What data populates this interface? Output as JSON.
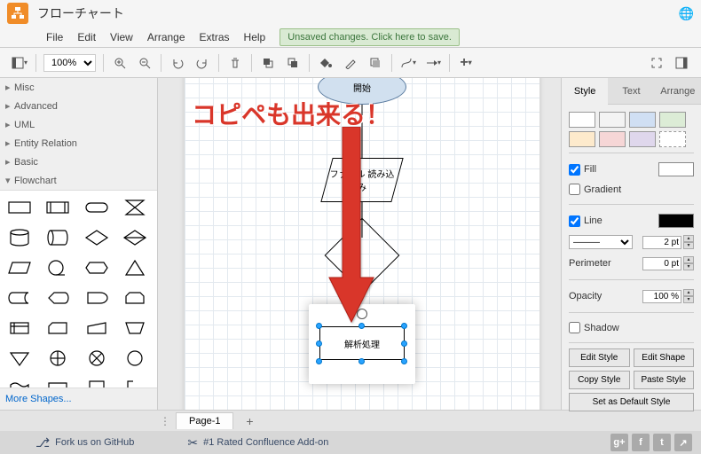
{
  "title": "フローチャート",
  "menus": [
    "File",
    "Edit",
    "View",
    "Arrange",
    "Extras",
    "Help"
  ],
  "save_notice": "Unsaved changes. Click here to save.",
  "zoom": "100%",
  "sidebar_cats": [
    {
      "label": "Misc",
      "open": false
    },
    {
      "label": "Advanced",
      "open": false
    },
    {
      "label": "UML",
      "open": false
    },
    {
      "label": "Entity Relation",
      "open": false
    },
    {
      "label": "Basic",
      "open": false
    },
    {
      "label": "Flowchart",
      "open": true
    }
  ],
  "more_shapes": "More Shapes...",
  "page_tab": "Page-1",
  "overlay": "コピペも出来る！",
  "nodes": {
    "start": "開始",
    "file": "ファイル\n読み込み",
    "proc": "解析処理"
  },
  "right_tabs": [
    "Style",
    "Text",
    "Arrange"
  ],
  "swatches_top": [
    "#ffffff",
    "#f3f3f3",
    "#d0dff3",
    "#dcecd6"
  ],
  "swatches_bot": [
    "#fdeacc",
    "#f6d6d6",
    "#dfd7ec",
    "#ffffff"
  ],
  "props": {
    "fill": "Fill",
    "fill_val": "#ffffff",
    "fill_checked": true,
    "gradient": "Gradient",
    "gradient_checked": false,
    "line": "Line",
    "line_val": "#000000",
    "line_checked": true,
    "line_width": "2 pt",
    "perimeter": "Perimeter",
    "perimeter_val": "0 pt",
    "opacity": "Opacity",
    "opacity_val": "100 %",
    "shadow": "Shadow",
    "shadow_checked": false
  },
  "buttons": {
    "edit_style": "Edit Style",
    "edit_shape": "Edit Shape",
    "copy_style": "Copy Style",
    "paste_style": "Paste Style",
    "default_style": "Set as Default Style"
  },
  "footer": {
    "fork": "Fork us on GitHub",
    "confluence": "#1 Rated Confluence Add-on"
  }
}
